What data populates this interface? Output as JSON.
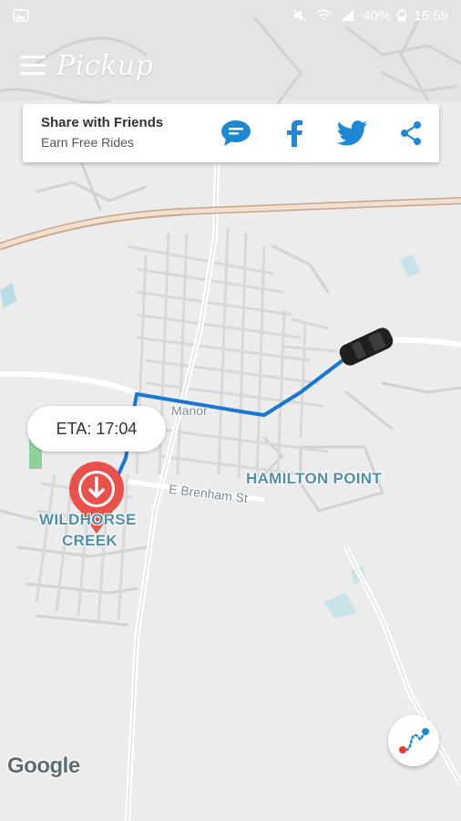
{
  "status_bar": {
    "battery": "40%",
    "time": "15:59"
  },
  "app": {
    "title": "Pickup"
  },
  "share": {
    "title": "Share with Friends",
    "subtitle": "Earn Free Rides",
    "buttons": [
      {
        "name": "chat-icon",
        "color": "#1e88d6"
      },
      {
        "name": "facebook-icon",
        "color": "#1e88d6"
      },
      {
        "name": "twitter-icon",
        "color": "#1e88d6"
      },
      {
        "name": "share-icon",
        "color": "#1e88d6"
      }
    ]
  },
  "map": {
    "eta_text": "ETA: 17:04",
    "labels": {
      "area_1": "WILDHORSE",
      "area_1b": "CREEK",
      "area_2": "HAMILTON POINT",
      "street_1": "Manor",
      "street_2": "E Brenham St"
    },
    "attribution": "Google",
    "route_color": "#1976d2",
    "pin_color": "#e9524a",
    "highway_color": "#d7b8a0"
  },
  "fab": {
    "icon": "route-icon"
  }
}
